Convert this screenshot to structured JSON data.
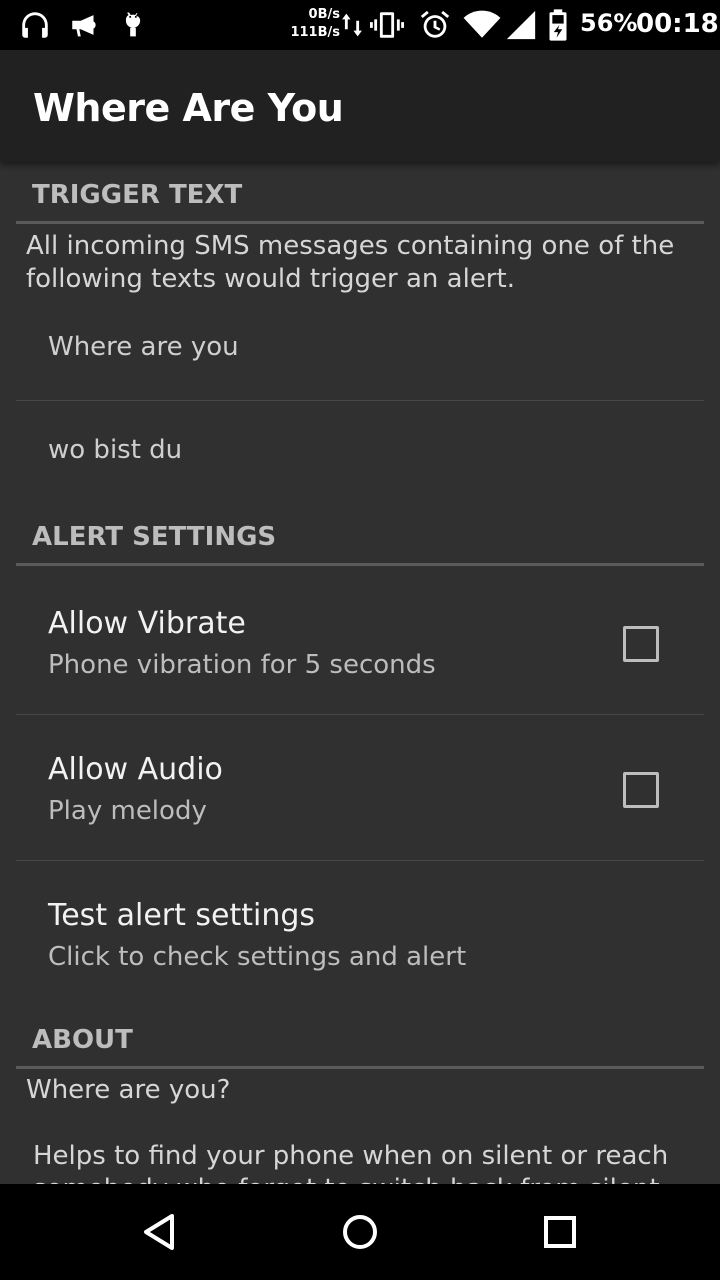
{
  "status_bar": {
    "icons_left": [
      "headset-icon",
      "megaphone-icon",
      "android-icon"
    ],
    "net_down": "0B/s",
    "net_up": "111B/s",
    "icons_right": [
      "data-transfer-icon",
      "vibrate-icon",
      "alarm-icon",
      "wifi-icon",
      "cell-signal-icon",
      "battery-charging-icon"
    ],
    "battery": "56%",
    "time": "00:18"
  },
  "app_bar": {
    "title": "Where Are You"
  },
  "trigger_text": {
    "header": "TRIGGER TEXT",
    "description": "All incoming SMS messages containing one of the following texts would trigger an alert.",
    "items": [
      "Where are you",
      "wo bist du"
    ]
  },
  "alert_settings": {
    "header": "ALERT SETTINGS",
    "vibrate": {
      "title": "Allow Vibrate",
      "summary": "Phone vibration for 5 seconds",
      "checked": false
    },
    "audio": {
      "title": "Allow Audio",
      "summary": "Play melody",
      "checked": false
    },
    "test": {
      "title": "Test alert settings",
      "summary": "Click to check settings and alert"
    }
  },
  "about": {
    "header": "ABOUT",
    "line1": "Where are you?",
    "line2": "Helps to find your phone when on silent or reach",
    "line3": "somebody who forgot to switch back from silent"
  },
  "nav_bar": {
    "buttons": [
      "back-icon",
      "home-icon",
      "recents-icon"
    ]
  },
  "colors": {
    "background": "#303030",
    "app_bar": "#212121",
    "status_bar": "#000000",
    "divider": "#5a5a5a"
  }
}
